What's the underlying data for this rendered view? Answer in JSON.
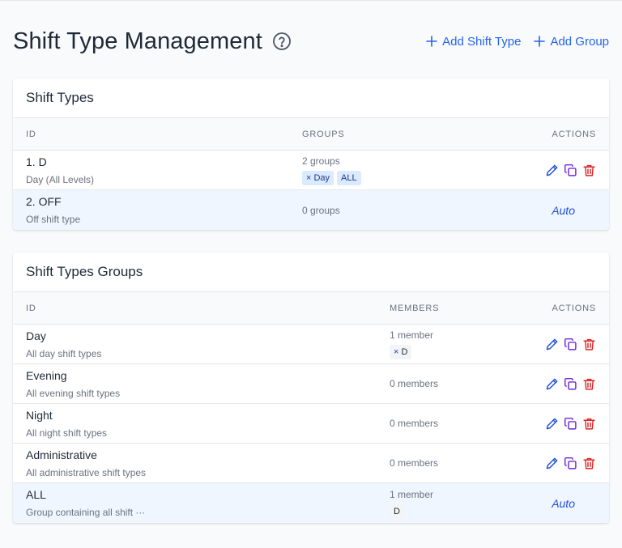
{
  "page": {
    "title": "Shift Type Management",
    "add_shift_type_label": "Add Shift Type",
    "add_group_label": "Add Group"
  },
  "shift_types": {
    "title": "Shift Types",
    "columns": {
      "id": "ID",
      "groups": "GROUPS",
      "actions": "ACTIONS"
    },
    "rows": [
      {
        "name": "1. D",
        "desc": "Day (All Levels)",
        "count": "2 groups",
        "chips": [
          {
            "x": "×",
            "label": "Day"
          },
          {
            "label": "ALL"
          }
        ]
      },
      {
        "name": "2. OFF",
        "desc": "Off shift type",
        "count": "0 groups",
        "auto": "Auto"
      }
    ]
  },
  "groups": {
    "title": "Shift Types Groups",
    "columns": {
      "id": "ID",
      "members": "MEMBERS",
      "actions": "ACTIONS"
    },
    "rows": [
      {
        "name": "Day",
        "desc": "All day shift types",
        "count": "1 member",
        "chips": [
          {
            "x": "×",
            "label": "D"
          }
        ]
      },
      {
        "name": "Evening",
        "desc": "All evening shift types",
        "count": "0 members"
      },
      {
        "name": "Night",
        "desc": "All night shift types",
        "count": "0 members"
      },
      {
        "name": "Administrative",
        "desc": "All administrative shift types",
        "count": "0 members"
      },
      {
        "name": "ALL",
        "desc": "Group containing all shift ···",
        "count": "1 member",
        "chips": [
          {
            "label": "D"
          }
        ],
        "auto": "Auto"
      }
    ]
  },
  "colors": {
    "accent": "#2563eb",
    "edit_icon": "#1d4ed8",
    "copy_icon": "#6d28d9",
    "delete_icon": "#dc2626"
  },
  "icons": [
    "help-circle-icon",
    "plus-icon",
    "pencil-icon",
    "copy-icon",
    "trash-icon"
  ]
}
